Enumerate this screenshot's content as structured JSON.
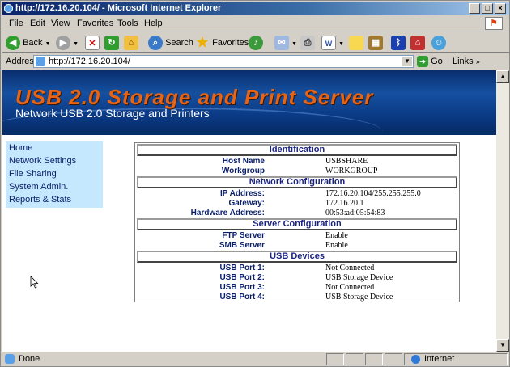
{
  "window": {
    "title": "http://172.16.20.104/ - Microsoft Internet Explorer",
    "min_label": "_",
    "max_label": "□",
    "close_label": "×"
  },
  "menu": [
    "File",
    "Edit",
    "View",
    "Favorites",
    "Tools",
    "Help"
  ],
  "toolbar": {
    "back_label": "Back",
    "search_label": "Search",
    "favorites_label": "Favorites"
  },
  "address": {
    "label": "Address",
    "url": "http://172.16.20.104/",
    "go_label": "Go",
    "links_label": "Links"
  },
  "banner": {
    "title": "USB 2.0 Storage and Print Server",
    "subtitle": "Network USB 2.0 Storage and Printers"
  },
  "nav": [
    "Home",
    "Network Settings",
    "File Sharing",
    "System Admin.",
    "Reports & Stats"
  ],
  "sections": [
    {
      "title": "Identification",
      "rows": [
        {
          "k": "Host Name",
          "v": "USBSHARE"
        },
        {
          "k": "Workgroup",
          "v": "WORKGROUP"
        }
      ]
    },
    {
      "title": "Network Configuration",
      "rows": [
        {
          "k": "IP Address:",
          "v": "172.16.20.104/255.255.255.0"
        },
        {
          "k": "Gateway:",
          "v": "172.16.20.1"
        },
        {
          "k": "Hardware Address:",
          "v": "00:53:ad:05:54:83"
        }
      ]
    },
    {
      "title": "Server Configuration",
      "rows": [
        {
          "k": "FTP Server",
          "v": "Enable"
        },
        {
          "k": "SMB Server",
          "v": "Enable"
        }
      ]
    },
    {
      "title": "USB Devices",
      "rows": [
        {
          "k": "USB Port 1:",
          "v": "Not Connected"
        },
        {
          "k": "USB Port 2:",
          "v": "USB Storage Device"
        },
        {
          "k": "USB Port 3:",
          "v": "Not Connected"
        },
        {
          "k": "USB Port 4:",
          "v": "USB Storage Device"
        }
      ]
    }
  ],
  "status": {
    "left": "Done",
    "zone": "Internet"
  }
}
